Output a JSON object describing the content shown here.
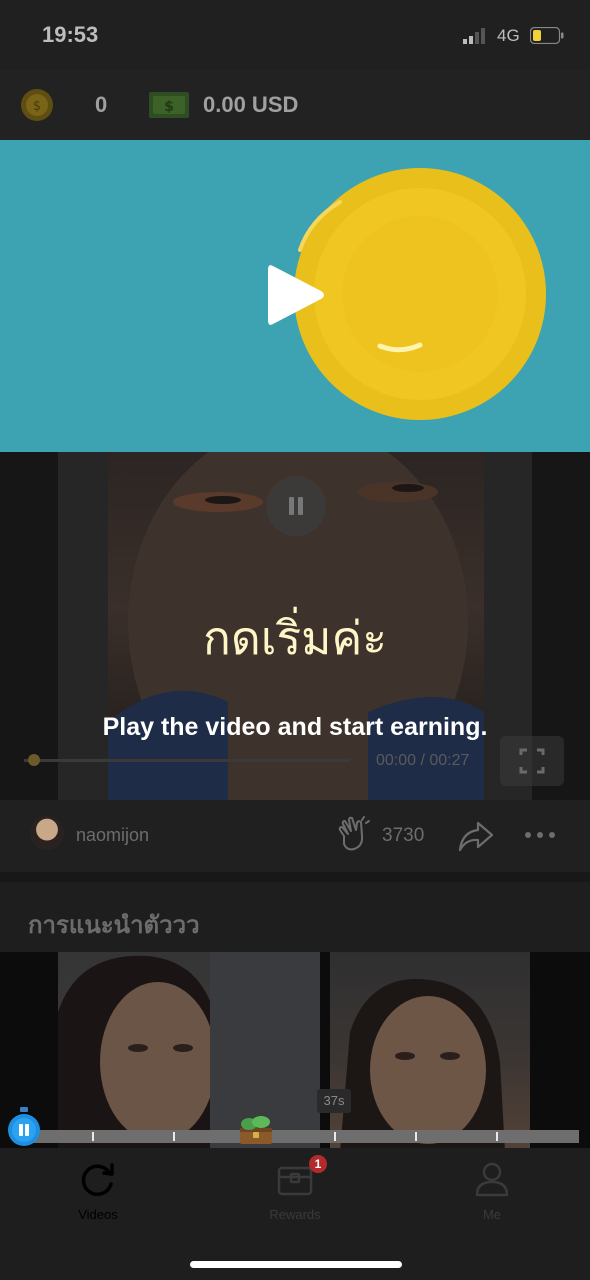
{
  "status_bar": {
    "time": "19:53",
    "network": "4G"
  },
  "balance": {
    "coins": "0",
    "cash": "0.00 USD"
  },
  "video": {
    "caption_thai": "กดเริ่มค่ะ",
    "hint": "Play the video and start earning.",
    "time": "00:00 / 00:27"
  },
  "meta": {
    "username": "naomijon",
    "likes": "3730"
  },
  "section": {
    "title": "การแนะนำตัววว"
  },
  "recommendation": {
    "duration": "37s"
  },
  "rewards_badge": "1",
  "tabs": [
    {
      "label": "Videos",
      "icon": "refresh-icon"
    },
    {
      "label": "Rewards",
      "icon": "chest-icon"
    },
    {
      "label": "Me",
      "icon": "user-icon"
    }
  ],
  "colors": {
    "accent_blue": "#1e8fe0",
    "badge_red": "#b32a2a",
    "tutorial_bg": "#3da3b2"
  }
}
